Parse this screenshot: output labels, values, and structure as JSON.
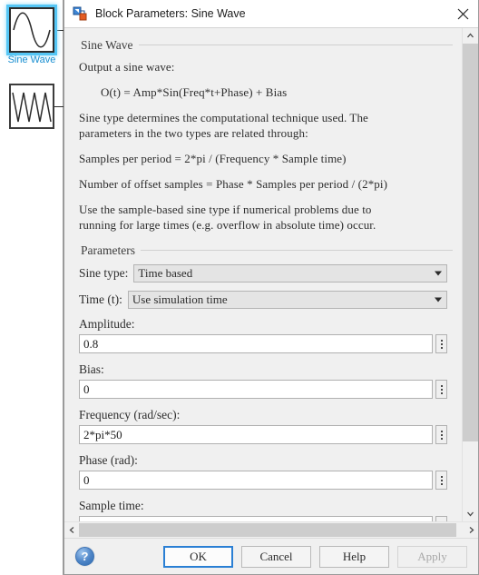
{
  "canvas": {
    "blocks": [
      {
        "name": "sine-wave-block",
        "label": "Sine Wave",
        "icon": "sine-wave-icon",
        "selected": true
      },
      {
        "name": "triangle-wave-block",
        "label": "",
        "icon": "triangle-wave-icon",
        "selected": false
      }
    ]
  },
  "dialog": {
    "title": "Block Parameters: Sine Wave",
    "title_icon": "simulink-block-icon",
    "close_label": "✕",
    "description_group": {
      "title": "Sine Wave",
      "paragraphs": [
        "Output a sine wave:",
        "O(t) = Amp*Sin(Freq*t+Phase) + Bias",
        "Sine type determines the computational technique used. The\nparameters in the two types are related through:",
        "Samples per period = 2*pi / (Frequency * Sample time)",
        "Number of offset samples = Phase * Samples per period / (2*pi)",
        "Use the sample-based sine type if numerical problems due to\nrunning for large times (e.g. overflow in absolute time) occur."
      ]
    },
    "parameters_group": {
      "title": "Parameters",
      "sine_type": {
        "label": "Sine type:",
        "value": "Time based"
      },
      "time_t": {
        "label": "Time (t):",
        "value": "Use simulation time"
      },
      "amplitude": {
        "label": "Amplitude:",
        "value": "0.8"
      },
      "bias": {
        "label": "Bias:",
        "value": "0"
      },
      "frequency": {
        "label": "Frequency (rad/sec):",
        "value": "2*pi*50"
      },
      "phase": {
        "label": "Phase (rad):",
        "value": "0"
      },
      "sample_time": {
        "label": "Sample time:",
        "value": ""
      }
    },
    "footer": {
      "help_glyph": "?",
      "ok_label": "OK",
      "cancel_label": "Cancel",
      "help_label": "Help",
      "apply_label": "Apply"
    }
  }
}
